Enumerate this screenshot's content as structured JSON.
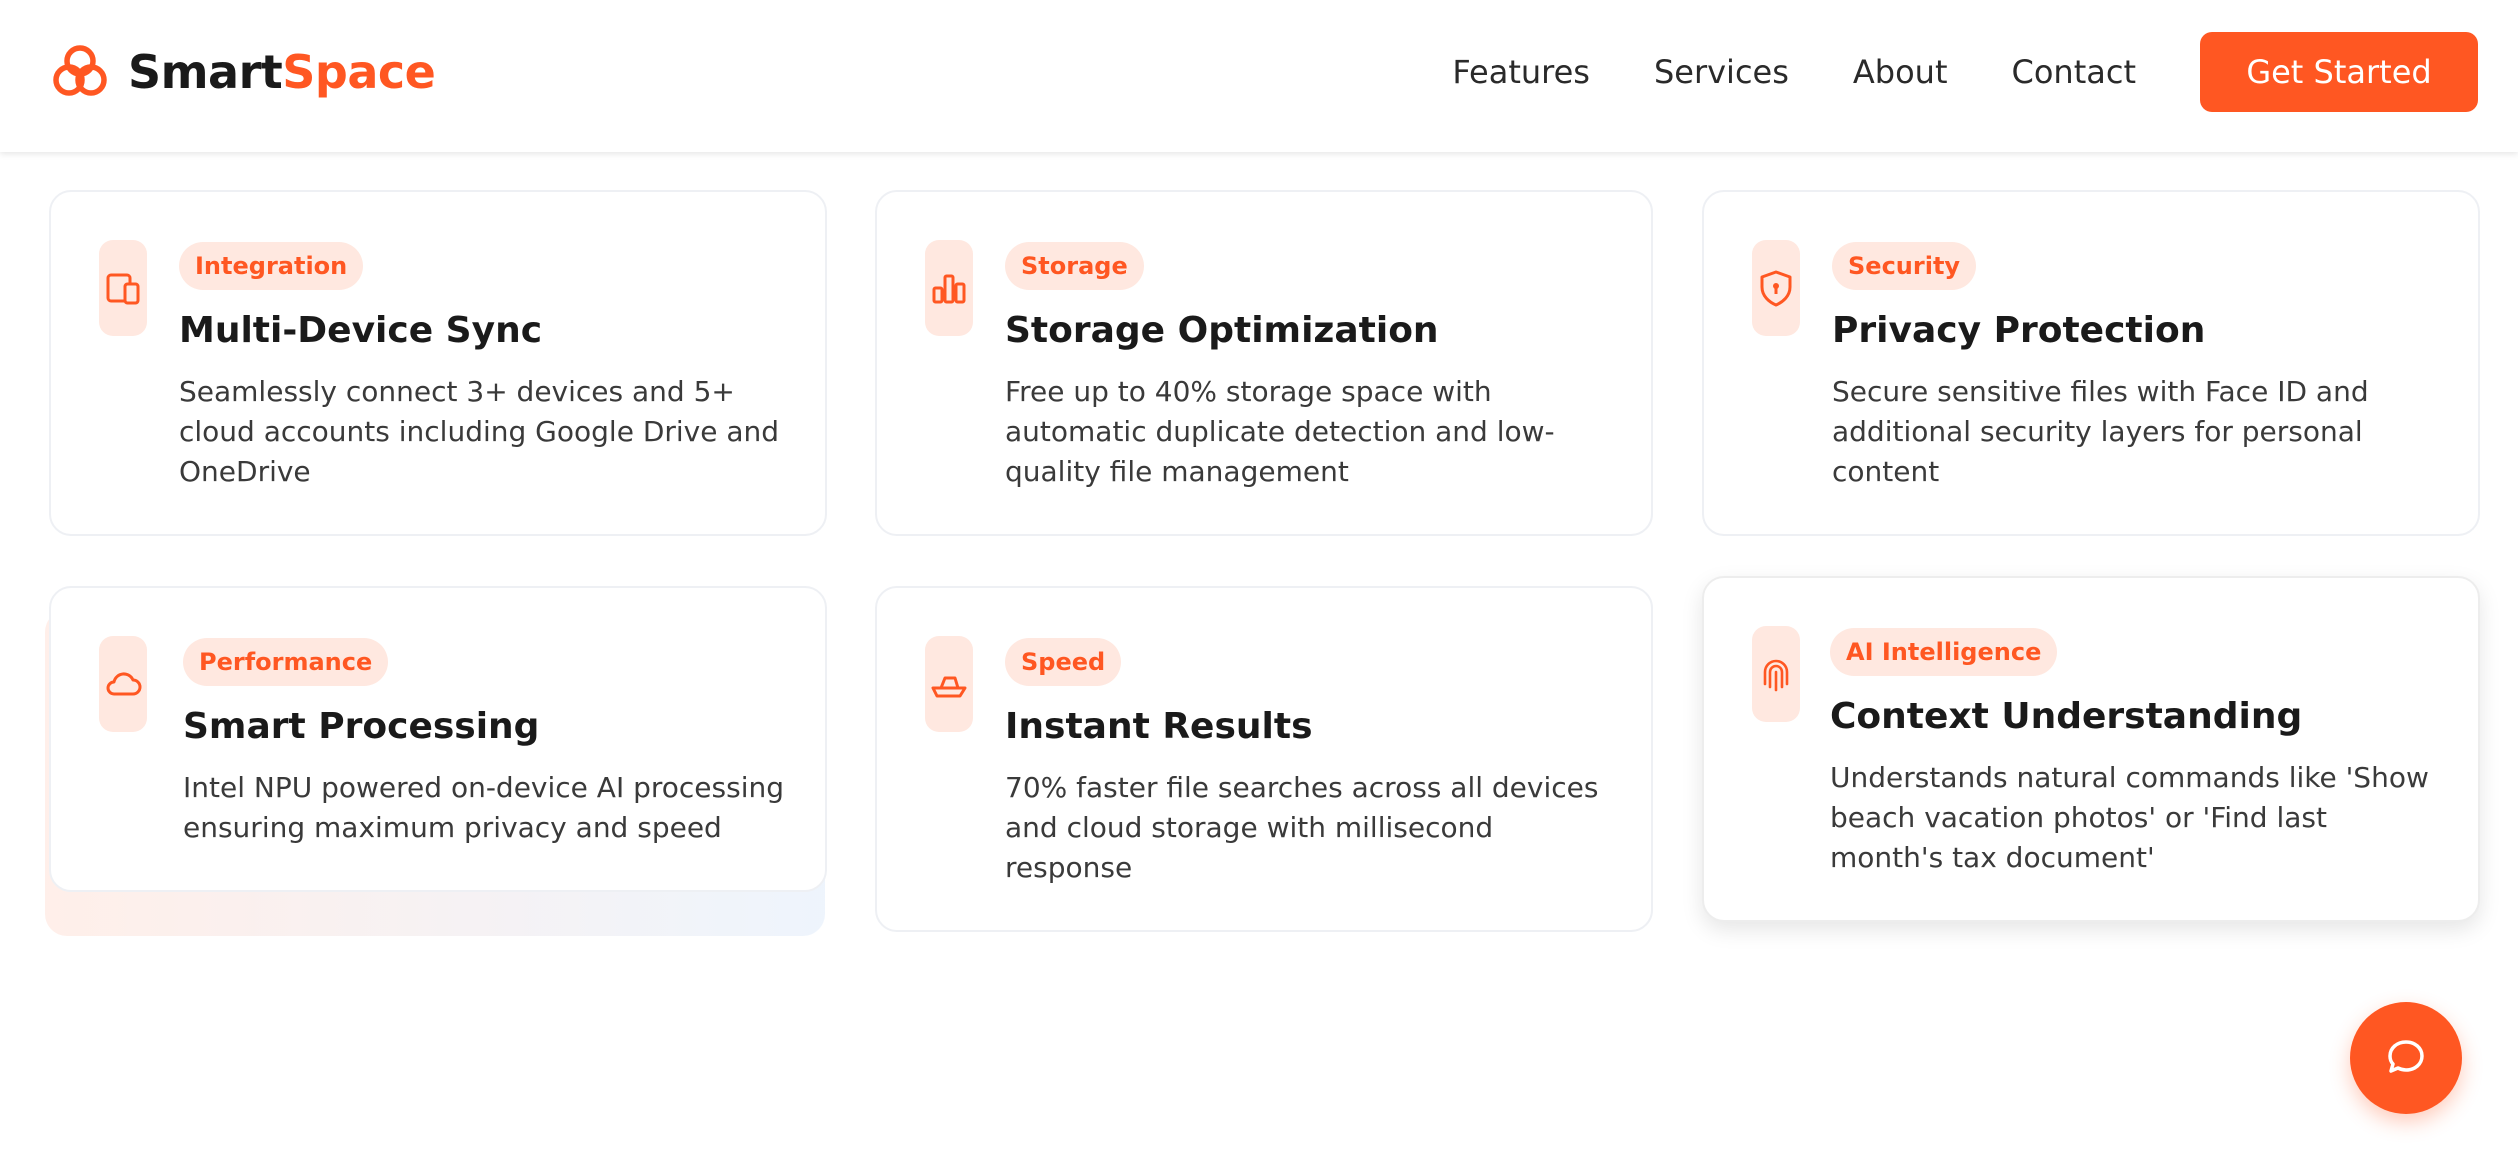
{
  "brand": {
    "name_part1": "Smart",
    "name_part2": "Space",
    "accent": "#ff5722"
  },
  "nav": {
    "links": [
      "Features",
      "Services",
      "About",
      "Contact"
    ],
    "cta_label": "Get Started"
  },
  "cards": [
    {
      "icon": "devices-icon",
      "tag": "Integration",
      "title": "Multi-Device Sync",
      "description": "Seamlessly connect 3+ devices and 5+ cloud accounts including Google Drive and OneDrive"
    },
    {
      "icon": "bar-chart-icon",
      "tag": "Storage",
      "title": "Storage Optimization",
      "description": "Free up to 40% storage space with automatic duplicate detection and low-quality file management"
    },
    {
      "icon": "shield-lock-icon",
      "tag": "Security",
      "title": "Privacy Protection",
      "description": "Secure sensitive files with Face ID and additional security layers for personal content"
    },
    {
      "icon": "cloud-icon",
      "tag": "Performance",
      "title": "Smart Processing",
      "description": "Intel NPU powered on-device AI processing ensuring maximum privacy and speed"
    },
    {
      "icon": "speedboat-icon",
      "tag": "Speed",
      "title": "Instant Results",
      "description": "70% faster file searches across all devices and cloud storage with millisecond response"
    },
    {
      "icon": "fingerprint-icon",
      "tag": "AI Intelligence",
      "title": "Context Understanding",
      "description": "Understands natural commands like 'Show beach vacation photos' or 'Find last month's tax document'"
    }
  ],
  "chat": {
    "icon": "chat-bubble-icon"
  }
}
